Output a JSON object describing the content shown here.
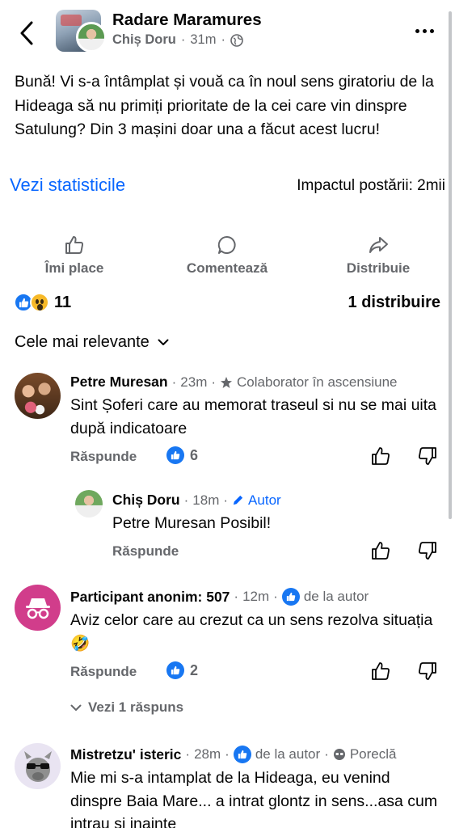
{
  "header": {
    "group_name": "Radare Maramures",
    "author": "Chiș Doru",
    "time": "31m",
    "separator": "·"
  },
  "post": {
    "text": "Bună! Vi s-a întâmplat și vouă ca în noul sens giratoriu de la Hideaga să nu primiți prioritate de la cei care vin dinspre Satulung? Din 3 mașini doar una a făcut acest lucru!",
    "stats_link": "Vezi statisticile",
    "impact": "Impactul postării: 2mii"
  },
  "actions": {
    "like": "Îmi place",
    "comment": "Comentează",
    "share": "Distribuie"
  },
  "summary": {
    "reaction_count": "11",
    "shares": "1 distribuire"
  },
  "sort": {
    "label": "Cele mai relevante"
  },
  "comments": [
    {
      "name": "Petre Muresan",
      "time": "23m",
      "badge": "Colaborator în ascensiune",
      "text": "Sint Șoferi care au memorat traseul si nu se mai uita după indicatoare",
      "reply": "Răspunde",
      "likes": "6"
    },
    {
      "name": "Chiș Doru",
      "time": "18m",
      "badge": "Autor",
      "text": "Petre Muresan Posibil!",
      "reply": "Răspunde"
    },
    {
      "name": "Participant anonim: 507",
      "time": "12m",
      "badge": "de la autor",
      "text": "Aviz celor care au crezut ca un sens rezolva situația 🤣",
      "reply": "Răspunde",
      "likes": "2",
      "see_replies": "Vezi 1 răspuns"
    },
    {
      "name": "Mistretzu' isteric",
      "time": "28m",
      "badge": "de la autor",
      "badge2": "Poreclă",
      "text": "Mie mi s-a intamplat de la Hideaga, eu venind dinspre Baia Mare... a intrat glontz in sens...asa cum intrau si inainte"
    }
  ],
  "colors": {
    "accent": "#0866ff",
    "secondary_text": "#65676b",
    "anon_avatar": "#d13d8b"
  },
  "icons": [
    "back-icon",
    "more-icon",
    "globe-icon",
    "like-outline-icon",
    "comment-icon",
    "share-icon",
    "chevron-down-icon",
    "star-icon",
    "pencil-icon",
    "thumbs-up-icon",
    "thumbs-down-icon",
    "incognito-icon",
    "nickname-icon"
  ]
}
